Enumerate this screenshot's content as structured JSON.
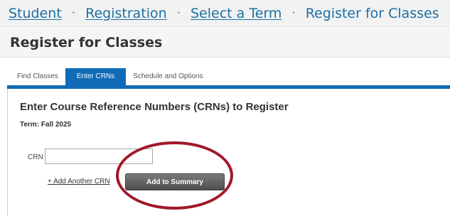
{
  "breadcrumb": {
    "items": [
      {
        "label": "Student"
      },
      {
        "label": "Registration"
      },
      {
        "label": "Select a Term"
      }
    ],
    "separator": "•",
    "current": "Register for Classes"
  },
  "header": {
    "title": "Register for Classes"
  },
  "tabs": [
    {
      "label": "Find Classes",
      "active": false
    },
    {
      "label": "Enter CRNs",
      "active": true
    },
    {
      "label": "Schedule and Options",
      "active": false
    }
  ],
  "panel": {
    "heading": "Enter Course Reference Numbers (CRNs) to Register",
    "term": "Term: Fall 2025",
    "crn_label": "CRN",
    "crn_value": "",
    "add_crn_link": "+ Add Another CRN",
    "add_button": "Add to Summary"
  },
  "colors": {
    "link": "#1b6fa5",
    "tab_active": "#0f6bb5",
    "highlight": "#a0182a",
    "button": "#5a5a5a"
  }
}
